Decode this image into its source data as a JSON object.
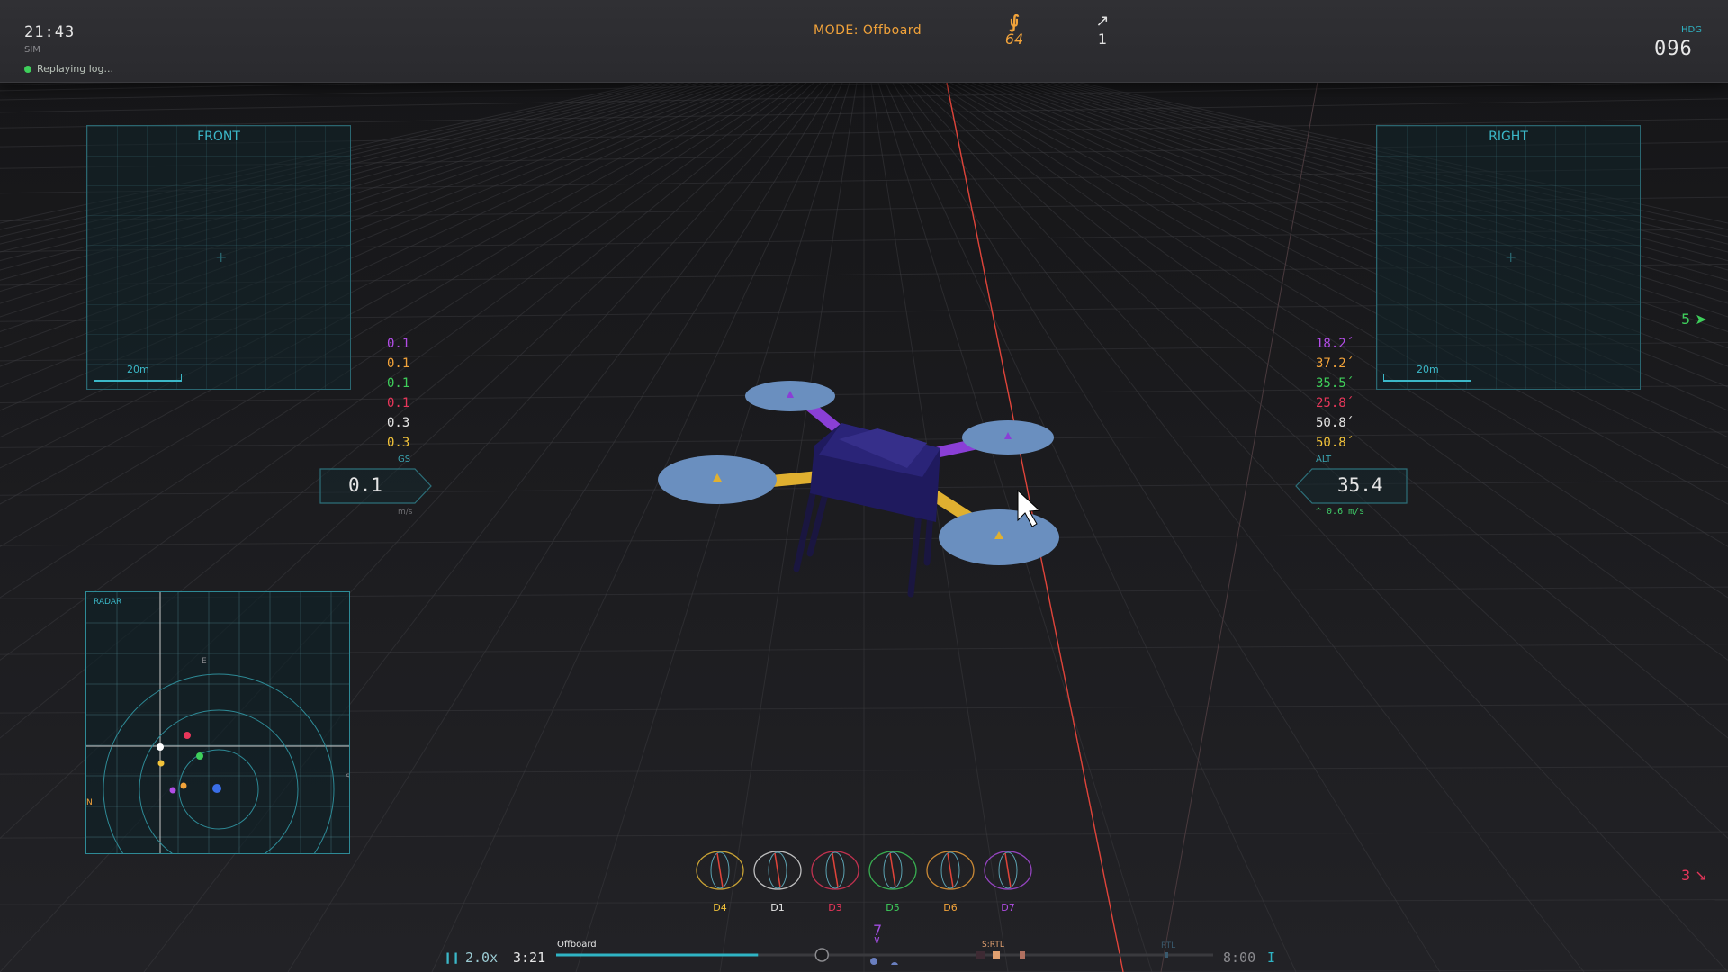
{
  "topbar": {
    "clock": "21:43",
    "sim_tag": "SIM",
    "replay_status": "Replaying log...",
    "mode": "MODE: Offboard",
    "satellites": "64",
    "link_count": "1",
    "heading_label": "HDG",
    "heading_value": "096"
  },
  "panels": {
    "front": {
      "title": "FRONT",
      "scale": "20m"
    },
    "right": {
      "title": "RIGHT",
      "scale": "20m"
    }
  },
  "speeds": [
    {
      "value": "0.1",
      "color": "#b24de6"
    },
    {
      "value": "0.1",
      "color": "#f2a33a"
    },
    {
      "value": "0.1",
      "color": "#3ecf5b"
    },
    {
      "value": "0.1",
      "color": "#e8365a"
    },
    {
      "value": "0.3",
      "color": "#e6e6e6"
    },
    {
      "value": "0.3",
      "color": "#f2c33a"
    }
  ],
  "altitudes": [
    {
      "value": "18.2",
      "color": "#b24de6"
    },
    {
      "value": "37.2",
      "color": "#f2a33a"
    },
    {
      "value": "35.5",
      "color": "#3ecf5b"
    },
    {
      "value": "25.8",
      "color": "#e8365a"
    },
    {
      "value": "50.8",
      "color": "#e6e6e6"
    },
    {
      "value": "50.8",
      "color": "#f2c33a"
    }
  ],
  "gs": {
    "label": "GS",
    "value": "0.1",
    "unit": "m/s"
  },
  "alt": {
    "label": "ALT",
    "value": "35.4",
    "vertical_speed": "^ 0.6 m/s"
  },
  "side_indicators": {
    "top_count": "5",
    "bottom_count": "3"
  },
  "radar": {
    "title": "RADAR",
    "north": "N",
    "east": "E",
    "south": "S"
  },
  "drones": [
    {
      "label": "D4",
      "color": "#f2c33a"
    },
    {
      "label": "D1",
      "color": "#e6e6e6"
    },
    {
      "label": "D3",
      "color": "#e8365a"
    },
    {
      "label": "D5",
      "color": "#3ecf5b"
    },
    {
      "label": "D6",
      "color": "#f2a33a"
    },
    {
      "label": "D7",
      "color": "#b24de6"
    }
  ],
  "playback": {
    "pause_icon": "pause-icon",
    "speed": "2.0x",
    "current_time": "3:21",
    "segment_mode": "Offboard",
    "marker_rtl_1": "S:RTL",
    "marker_rtl_2": "RTL",
    "end_time": "8:00",
    "progress": 0.48,
    "selected_drone": "7"
  },
  "colors": {
    "accent": "#3bb8c8",
    "mode": "#f2a33a",
    "rod": "#e0443a",
    "frame": "#1f1a5e",
    "prop": "#6a8fbf"
  }
}
